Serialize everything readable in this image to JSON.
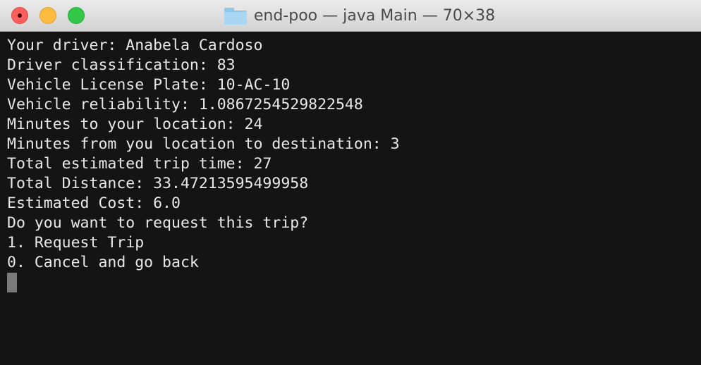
{
  "window": {
    "title": "end-poo — java Main — 70×38",
    "icon": "folder-icon",
    "buttons": [
      "close",
      "minimize",
      "zoom"
    ]
  },
  "terminal": {
    "lines": [
      "Your driver: Anabela Cardoso",
      "Driver classification: 83",
      "Vehicle License Plate: 10-AC-10",
      "Vehicle reliability: 1.0867254529822548",
      "Minutes to your location: 24",
      "Minutes from you location to destination: 3",
      "Total estimated trip time: 27",
      "Total Distance: 33.47213595499958",
      "Estimated Cost: 6.0",
      "Do you want to request this trip?",
      "1. Request Trip",
      "0. Cancel and go back"
    ]
  },
  "colors": {
    "background": "#141414",
    "text": "#e8e8e8",
    "cursor": "#7a7a7a"
  }
}
